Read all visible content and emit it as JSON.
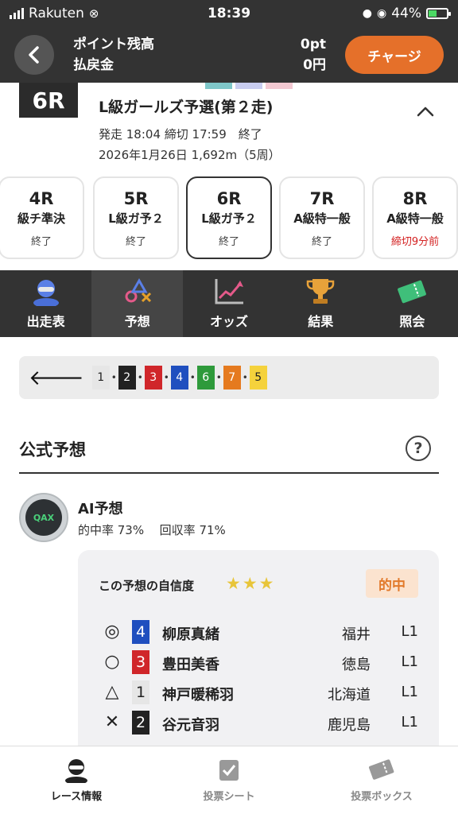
{
  "status_bar": {
    "carrier": "Rakuten",
    "time": "18:39",
    "battery": "44%",
    "battery_level": 0.44
  },
  "header": {
    "balance_label": "ポイント残高",
    "refund_label": "払戻金",
    "balance_value": "0pt",
    "refund_value": "0円",
    "charge_label": "チャージ"
  },
  "race": {
    "number": "6R",
    "title": "L級ガールズ予選(第２走)",
    "times": "発走 18:04 締切 17:59　終了",
    "date_info": "2026年1月26日 1,692m（5周）"
  },
  "race_tabs": [
    {
      "race": "4R",
      "name": "級チ準決",
      "status": "終了",
      "alert": false
    },
    {
      "race": "5R",
      "name": "L級ガ予２",
      "status": "終了",
      "alert": false
    },
    {
      "race": "6R",
      "name": "L級ガ予２",
      "status": "終了",
      "alert": false
    },
    {
      "race": "7R",
      "name": "A級特一般",
      "status": "終了",
      "alert": false
    },
    {
      "race": "8R",
      "name": "A級特一般",
      "status": "締切9分前",
      "alert": true
    }
  ],
  "nav": {
    "entries": "出走表",
    "prediction": "予想",
    "odds": "オッズ",
    "results": "結果",
    "inquiry": "照会"
  },
  "lineup": [
    {
      "num": "1",
      "bg": "#e6e6e6",
      "fg": "#222222"
    },
    {
      "num": "2",
      "bg": "#222222",
      "fg": "#ffffff"
    },
    {
      "num": "3",
      "bg": "#d0262a",
      "fg": "#ffffff"
    },
    {
      "num": "4",
      "bg": "#1f4fbf",
      "fg": "#ffffff"
    },
    {
      "num": "6",
      "bg": "#2e9a3b",
      "fg": "#ffffff"
    },
    {
      "num": "7",
      "bg": "#e57a1f",
      "fg": "#ffffff"
    },
    {
      "num": "5",
      "bg": "#f5d23c",
      "fg": "#222222"
    }
  ],
  "section": {
    "title": "公式予想"
  },
  "ai": {
    "name": "AI予想",
    "badge": "QAX",
    "hit_rate": "的中率 73%",
    "return_rate": "回収率 71%"
  },
  "prediction": {
    "confidence_label": "この予想の自信度",
    "stars": "★★★",
    "result": "的中",
    "rows": [
      {
        "mark": "◎",
        "num": "4",
        "bg": "#1f4fbf",
        "fg": "#ffffff",
        "name": "柳原真緒",
        "pref": "福井",
        "cls": "L1"
      },
      {
        "mark": "○",
        "num": "3",
        "bg": "#d0262a",
        "fg": "#ffffff",
        "name": "豊田美香",
        "pref": "徳島",
        "cls": "L1"
      },
      {
        "mark": "△",
        "num": "1",
        "bg": "#e6e6e6",
        "fg": "#222222",
        "name": "神戸暖稀羽",
        "pref": "北海道",
        "cls": "L1"
      },
      {
        "mark": "✕",
        "num": "2",
        "bg": "#222222",
        "fg": "#ffffff",
        "name": "谷元音羽",
        "pref": "鹿児島",
        "cls": "L1"
      }
    ]
  },
  "tabbar": {
    "race_info": "レース情報",
    "bet_sheet": "投票シート",
    "bet_box": "投票ボックス"
  }
}
